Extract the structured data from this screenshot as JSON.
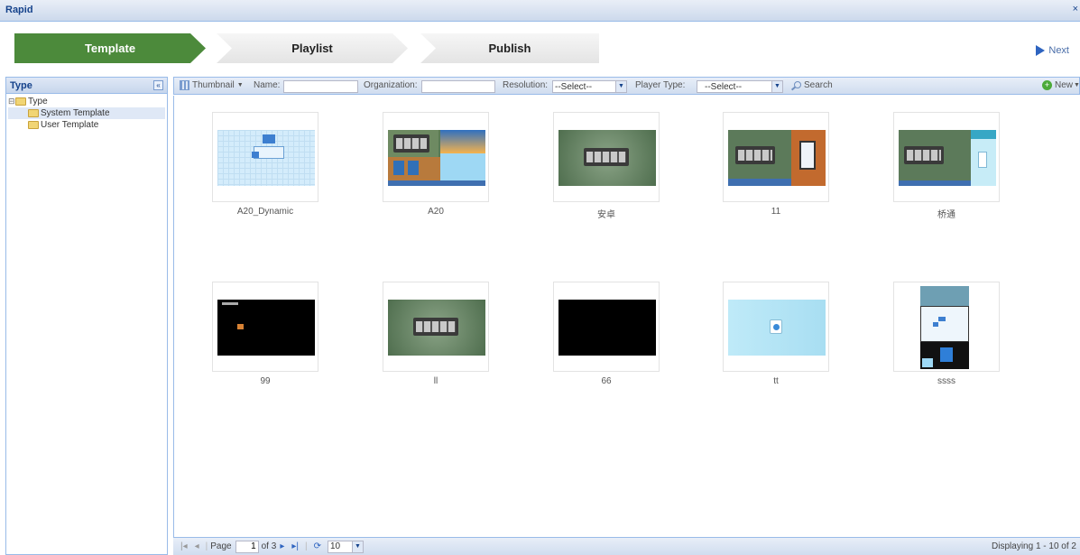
{
  "window": {
    "title": "Rapid",
    "close_glyph": "×"
  },
  "wizard": {
    "steps": [
      {
        "label": "Template",
        "active": true
      },
      {
        "label": "Playlist",
        "active": false
      },
      {
        "label": "Publish",
        "active": false
      }
    ],
    "next_label": "Next"
  },
  "left_panel": {
    "title": "Type",
    "collapse_glyph": "«",
    "tree": {
      "root": "Type",
      "children": [
        "System Template",
        "User Template"
      ],
      "selected": "System Template"
    }
  },
  "toolbar": {
    "view_label": "Thumbnail",
    "name_label": "Name:",
    "name_value": "",
    "organization_label": "Organization:",
    "organization_value": "",
    "resolution_label": "Resolution:",
    "resolution_value": "--Select--",
    "player_type_label": "Player Type:",
    "player_type_value": "--Select--",
    "search_label": "Search",
    "new_label": "New"
  },
  "templates": [
    {
      "name": "A20_Dynamic"
    },
    {
      "name": "A20"
    },
    {
      "name": "安卓"
    },
    {
      "name": "11"
    },
    {
      "name": "桥通"
    },
    {
      "name": "99"
    },
    {
      "name": "ll"
    },
    {
      "name": "66"
    },
    {
      "name": "tt"
    },
    {
      "name": "ssss"
    }
  ],
  "pager": {
    "page_label": "Page",
    "page_value": "1",
    "of_label": "of 3",
    "page_size": "10",
    "display_text": "Displaying 1 - 10 of 2"
  },
  "colors": {
    "accent": "#4c8a3b",
    "border": "#99bbe8",
    "header_text": "#15428b"
  }
}
